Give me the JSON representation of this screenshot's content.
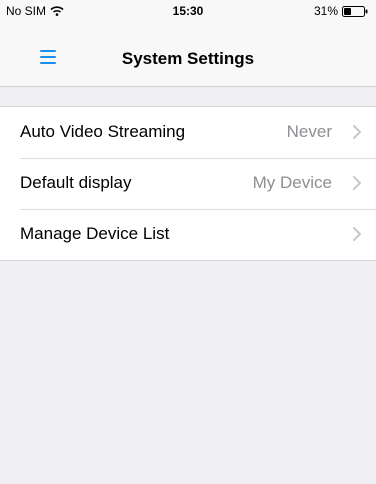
{
  "status_bar": {
    "carrier": "No SIM",
    "time": "15:30",
    "battery": "31%",
    "wifi_icon": "wifi-icon",
    "battery_icon": "battery-icon"
  },
  "nav": {
    "title": "System Settings",
    "menu_icon": "hamburger-menu-icon",
    "accent_color": "#1d8df2"
  },
  "settings": [
    {
      "label": "Auto Video Streaming",
      "value": "Never"
    },
    {
      "label": "Default display",
      "value": "My Device"
    },
    {
      "label": "Manage Device List",
      "value": ""
    }
  ]
}
